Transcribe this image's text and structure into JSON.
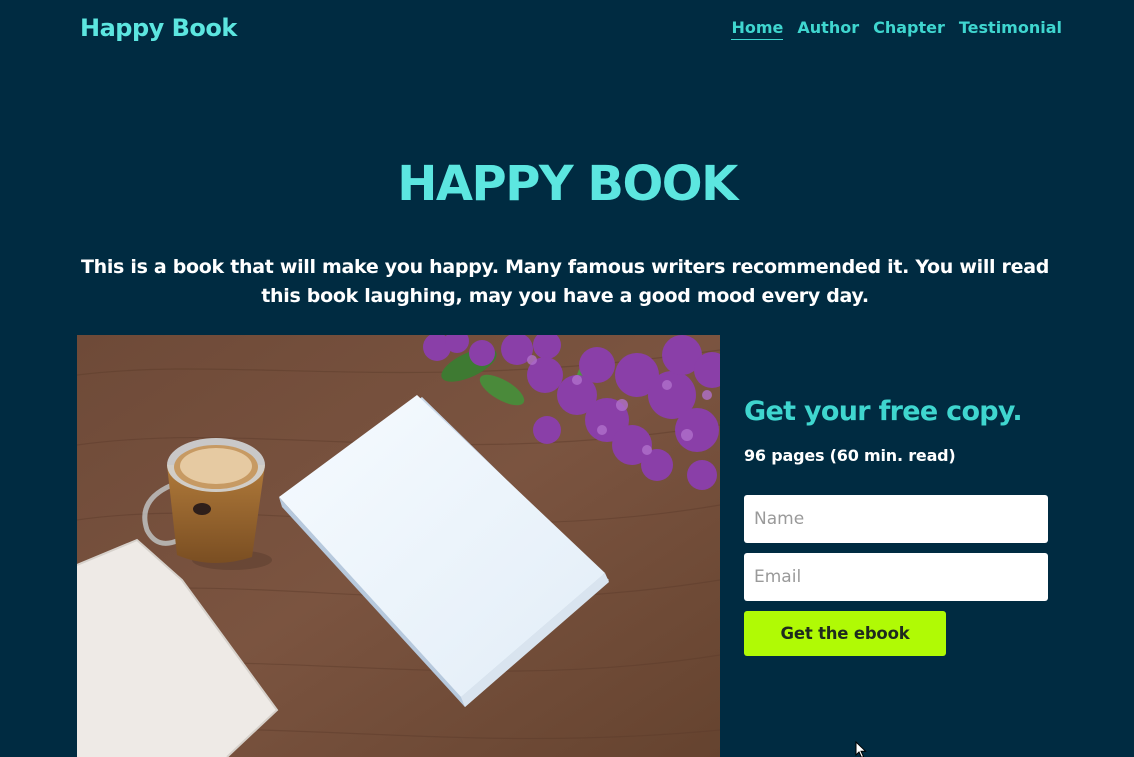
{
  "header": {
    "brand": "Happy Book",
    "nav": [
      {
        "label": "Home",
        "active": true
      },
      {
        "label": "Author",
        "active": false
      },
      {
        "label": "Chapter",
        "active": false
      },
      {
        "label": "Testimonial",
        "active": false
      }
    ]
  },
  "hero": {
    "title": "HAPPY BOOK",
    "description": "This is a book that will make you happy. Many famous writers recommended it. You will read this book laughing, may you have a good mood every day."
  },
  "signup": {
    "title": "Get your free copy.",
    "meta": "96 pages (60 min. read)",
    "name_placeholder": "Name",
    "email_placeholder": "Email",
    "button_label": "Get the ebook"
  },
  "colors": {
    "background": "#002b41",
    "accent": "#5ce6e0",
    "nav_link": "#3fd6cf",
    "cta": "#b0fa05"
  },
  "icons": {
    "cursor": "arrow-cursor-icon"
  }
}
